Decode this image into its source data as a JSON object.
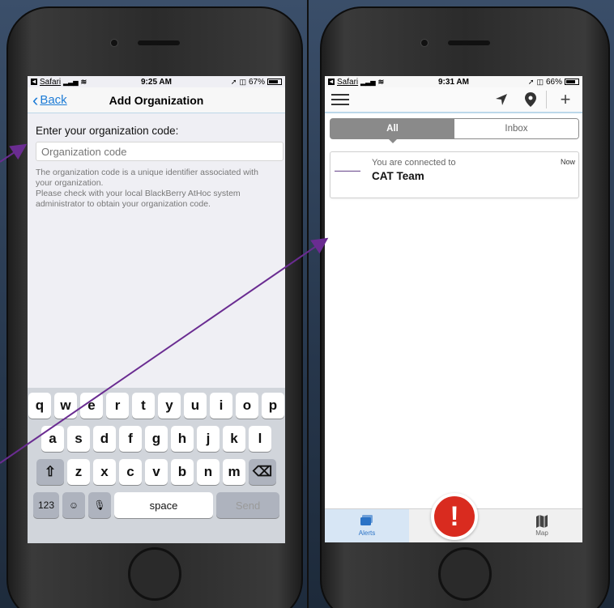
{
  "left_screen": {
    "status": {
      "app": "Safari",
      "time": "9:25 AM",
      "battery": "67%",
      "battery_level": 0.67
    },
    "nav": {
      "back_label": "Back",
      "title": "Add Organization"
    },
    "prompt": "Enter your organization code:",
    "input": {
      "value": "",
      "placeholder": "Organization code"
    },
    "help_text": "The organization code is a unique identifier associated with your organization.\nPlease check with your local BlackBerry AtHoc system administrator to obtain your organization code.",
    "keyboard": {
      "row1": [
        "q",
        "w",
        "e",
        "r",
        "t",
        "y",
        "u",
        "i",
        "o",
        "p"
      ],
      "row2": [
        "a",
        "s",
        "d",
        "f",
        "g",
        "h",
        "j",
        "k",
        "l"
      ],
      "row3": [
        "z",
        "x",
        "c",
        "v",
        "b",
        "n",
        "m"
      ],
      "numbers": "123",
      "space": "space",
      "send": "Send",
      "shift_icon": "⇧",
      "delete_icon": "⌫",
      "emoji_icon": "☺",
      "mic_icon": "🎙"
    }
  },
  "right_screen": {
    "status": {
      "app": "Safari",
      "time": "9:31 AM",
      "battery": "66%",
      "battery_level": 0.66
    },
    "segments": {
      "all": "All",
      "inbox": "Inbox"
    },
    "alert": {
      "subtitle": "You are connected to",
      "title": "CAT Team",
      "time": "Now"
    },
    "tabs": {
      "alerts": "Alerts",
      "map": "Map"
    },
    "panic_symbol": "!"
  },
  "colors": {
    "accent": "#1e7cd6",
    "panic": "#d92b1f",
    "arrow": "#6a2c91"
  }
}
